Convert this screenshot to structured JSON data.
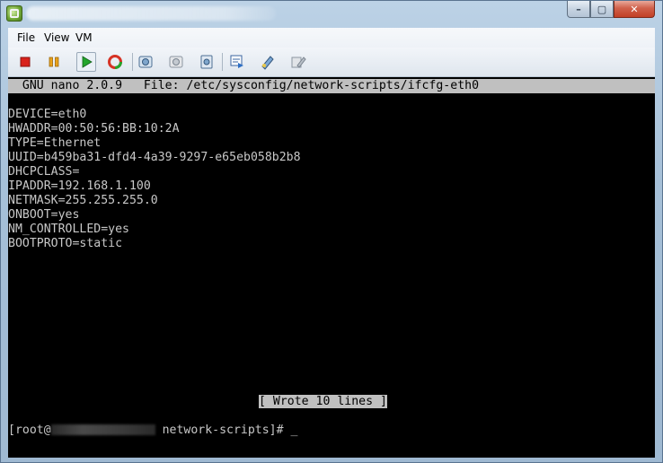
{
  "window": {
    "title_redacted": true,
    "controls": {
      "minimize": "–",
      "maximize": "▢",
      "close": "✕"
    }
  },
  "menu": {
    "items": [
      {
        "label": "File"
      },
      {
        "label": "View"
      },
      {
        "label": "VM"
      }
    ]
  },
  "toolbar": {
    "icons": [
      "power-off-icon",
      "pause-icon",
      "play-icon",
      "reset-icon",
      "snapshot-take-icon",
      "snapshot-revert-icon",
      "snapshot-manager-icon",
      "console-view-icon",
      "vm-settings-icon",
      "edit-settings-icon"
    ],
    "colors": {
      "stop": "#d8221c",
      "pause": "#e8a21b",
      "play": "#23a52c",
      "reset": "#d63325"
    }
  },
  "terminal": {
    "nano_header": "  GNU nano 2.0.9   File: /etc/sysconfig/network-scripts/ifcfg-eth0",
    "lines": [
      "DEVICE=eth0",
      "HWADDR=00:50:56:BB:10:2A",
      "TYPE=Ethernet",
      "UUID=b459ba31-dfd4-4a39-9297-e65eb058b2b8",
      "DHCPCLASS=",
      "IPADDR=192.168.1.100",
      "NETMASK=255.255.255.0",
      "ONBOOT=yes",
      "NM_CONTROLLED=yes",
      "BOOTPROTO=static"
    ],
    "status_message": "[ Wrote 10 lines ]",
    "prompt_prefix": "[root@",
    "prompt_suffix": " network-scripts]# ",
    "cursor": "_"
  }
}
